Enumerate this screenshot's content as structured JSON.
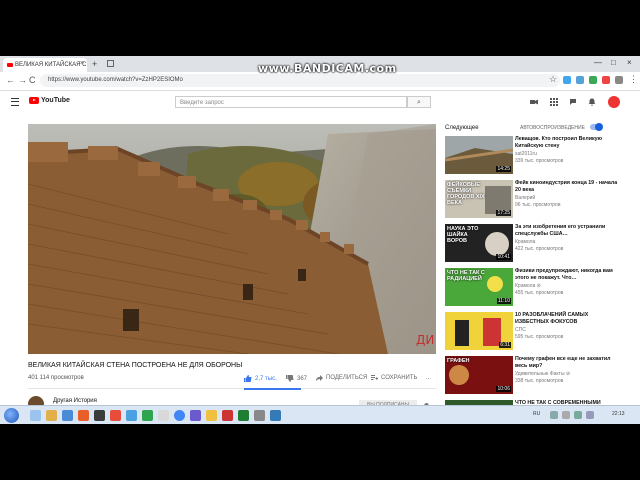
{
  "overlay": {
    "watermark": "www.BANDICAM.com"
  },
  "browser": {
    "tab_title": "ВЕЛИКАЯ КИТАЙСКАЯ С",
    "tab_close": "×",
    "new_tab": "+",
    "url": "https://www.youtube.com/watch?v=ZzHP2ESIOMo",
    "window_min": "—",
    "window_max": "□",
    "window_close": "×",
    "back": "←",
    "forward": "→",
    "reload": "C",
    "star": "☆",
    "menu": "⋮"
  },
  "header": {
    "logo_text": "YouTube",
    "search_placeholder": "Введите запрос",
    "search_icon": "⌕"
  },
  "video": {
    "title": "ВЕЛИКАЯ КИТАЙСКАЯ СТЕНА ПОСТРОЕНА НЕ ДЛЯ ОБОРОНЫ",
    "views": "401 114 просмотров",
    "likes": "2,7 тыс.",
    "dislikes": "367",
    "share": "ПОДЕЛИТЬСЯ",
    "save": "СОХРАНИТЬ",
    "more": "...",
    "channel": "Другая История",
    "subscribe": "ВЫ ПОДПИСАНЫ"
  },
  "sidebar": {
    "next_label": "Следующее",
    "autoplay_label": "АВТОВОСПРОИЗВЕДЕНИЕ",
    "items": [
      {
        "title": "Леващов. Кто построил Великую Китайскую стену",
        "channel": "sat2011ru",
        "views": "339 тыс. просмотров",
        "duration": "14:25",
        "thumb_text": "",
        "thumb": "wall"
      },
      {
        "title": "Фейк киноиндустрия конца 19 - начала 20 века",
        "channel": "Валерий",
        "views": "96 тыс. просмотров",
        "duration": "17:25",
        "thumb_text": "ФЕЙКОВЫЕ СЪЁМКИ ГОРОДОВ XIX ВЕКА",
        "thumb": "fake"
      },
      {
        "title": "За эти изобретения его устранили спецслужбы США…",
        "channel": "Крамола",
        "views": "422 тыс. просмотров",
        "duration": "10:41",
        "thumb_text": "НАУКА ЭТО ШАЙКА ВОРОВ",
        "thumb": "nauka"
      },
      {
        "title": "Физики предупреждают, никогда вам этого не покажут. Что…",
        "channel": "Крамола ⊘",
        "views": "455 тыс. просмотров",
        "duration": "11:10",
        "thumb_text": "ЧТО НЕ ТАК С РАДИАЦИЕЙ",
        "thumb": "radiation"
      },
      {
        "title": "10 РАЗОБЛАЧЕНИЙ САМЫХ ИЗВЕСТНЫХ ФОКУСОВ",
        "channel": "СПС",
        "views": "595 тыс. просмотров",
        "duration": "6:31",
        "thumb_text": "",
        "thumb": "fokus"
      },
      {
        "title": "Почему графен все еще не захватил весь мир?",
        "channel": "Удивительные Факты ⊘",
        "views": "338 тыс. просмотров",
        "duration": "10:06",
        "thumb_text": "ГРАФЕН",
        "thumb": "grafen"
      },
      {
        "title": "ЧТО НЕ ТАК С СОВРЕМЕННЫМИ РЕКАМИ?",
        "channel": "",
        "views": "",
        "duration": "",
        "thumb_text": "",
        "thumb": "river"
      }
    ]
  },
  "taskbar": {
    "lang": "RU",
    "time": "22:13"
  },
  "colors": {
    "accent": "#3a76f0",
    "youtube_red": "#ff0000",
    "taskbar": "#dbe6f4"
  }
}
